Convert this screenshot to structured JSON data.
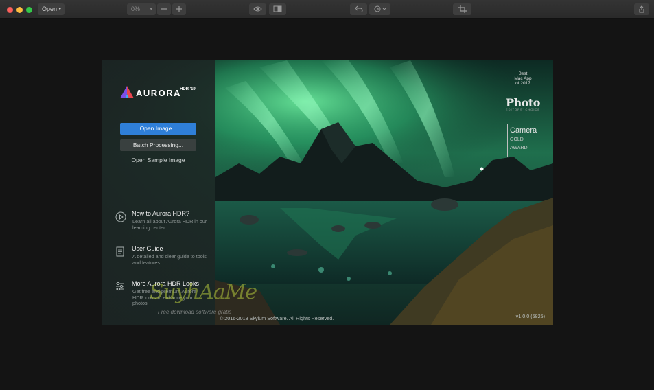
{
  "toolbar": {
    "open_label": "Open",
    "zoom_value": "0%",
    "icons": [
      "chevron-down-icon",
      "minus-icon",
      "plus-icon",
      "eye-icon",
      "compare-icon",
      "undo-icon",
      "history-icon",
      "crop-icon",
      "share-icon"
    ]
  },
  "dialog": {
    "logo_word": "AURORA",
    "logo_sup": "HDR '19",
    "open_image_label": "Open Image...",
    "batch_label": "Batch Processing...",
    "sample_label": "Open Sample Image",
    "resources": [
      {
        "title": "New to Aurora HDR?",
        "desc": "Learn all about Aurora HDR in our learning center",
        "icon": "play-icon"
      },
      {
        "title": "User Guide",
        "desc": "A detailed and clear guide to tools and features",
        "icon": "document-icon"
      },
      {
        "title": "More Aurora HDR Looks",
        "desc": "Get free and premium Aurora HDR looks to enhance your photos",
        "icon": "sliders-icon"
      }
    ],
    "copyright": "© 2016-2018 Skylum Software. All Rights Reserved.",
    "version": "v1.0.0 (5825)",
    "awards": {
      "best_line1": "Best",
      "best_line2": "Mac App",
      "best_line3": "of 2017",
      "photo_big": "Photo",
      "photo_small": "EDITORS' CHOICE",
      "camera_name": "Camera",
      "camera_gold": "GOLD",
      "camera_award": "AWARD"
    }
  },
  "watermark": {
    "text": "SuyhAaMe",
    "sub": "Free download software gratis"
  },
  "colors": {
    "accent": "#2f7fd8",
    "aurora_green": "#3cd58a"
  }
}
